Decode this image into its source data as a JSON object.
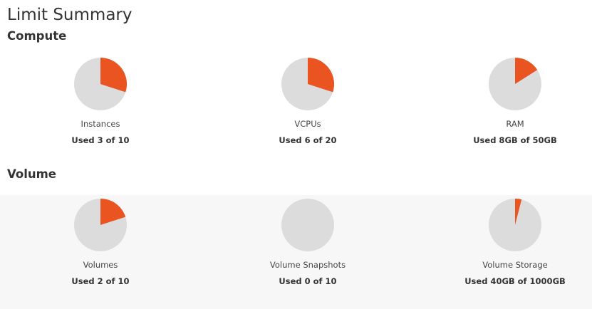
{
  "page_title": "Limit Summary",
  "colors": {
    "used": "#e95420",
    "free": "#dcdcdc"
  },
  "sections": [
    {
      "title": "Compute",
      "items": [
        {
          "label": "Instances",
          "used_text": "Used 3 of 10",
          "used": 3,
          "total": 10
        },
        {
          "label": "VCPUs",
          "used_text": "Used 6 of 20",
          "used": 6,
          "total": 20
        },
        {
          "label": "RAM",
          "used_text": "Used 8GB of 50GB",
          "used": 8,
          "total": 50
        }
      ]
    },
    {
      "title": "Volume",
      "items": [
        {
          "label": "Volumes",
          "used_text": "Used 2 of 10",
          "used": 2,
          "total": 10
        },
        {
          "label": "Volume Snapshots",
          "used_text": "Used 0 of 10",
          "used": 0,
          "total": 10
        },
        {
          "label": "Volume Storage",
          "used_text": "Used 40GB of 1000GB",
          "used": 40,
          "total": 1000
        }
      ]
    }
  ]
}
